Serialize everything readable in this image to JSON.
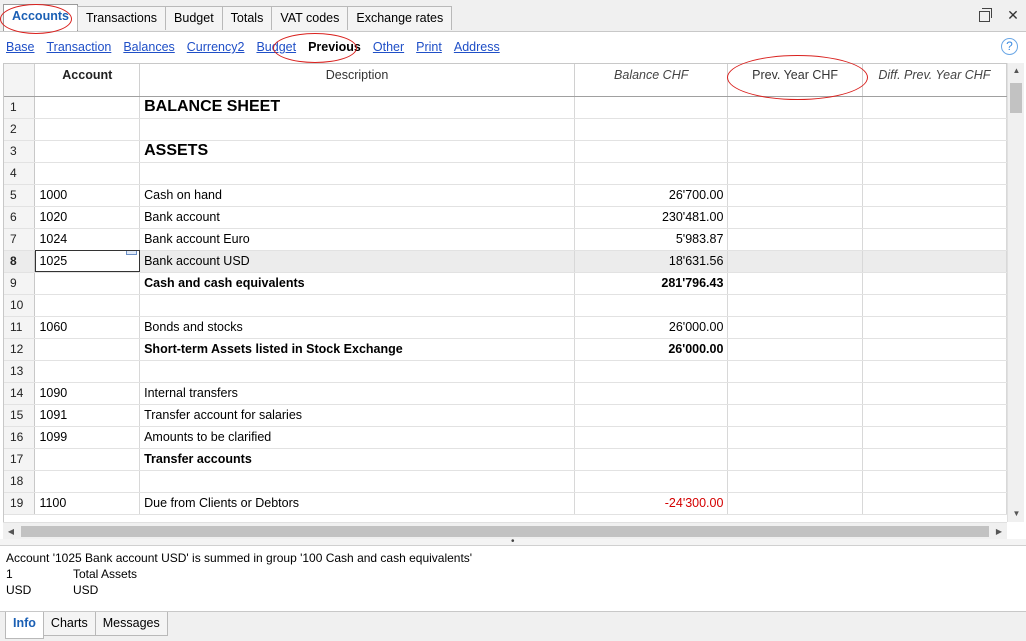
{
  "tabs": [
    "Accounts",
    "Transactions",
    "Budget",
    "Totals",
    "VAT codes",
    "Exchange rates"
  ],
  "active_tab": "Accounts",
  "views": [
    "Base",
    "Transaction",
    "Balances",
    "Currency2",
    "Budget",
    "Previous",
    "Other",
    "Print",
    "Address"
  ],
  "active_view": "Previous",
  "help_icon": "question-circle-icon",
  "columns": {
    "account": "Account",
    "description": "Description",
    "balance": "Balance CHF",
    "prev_year": "Prev. Year CHF",
    "diff_prev_year": "Diff. Prev. Year CHF"
  },
  "rows": [
    {
      "n": "1",
      "account": "",
      "description": "BALANCE SHEET",
      "balance": "",
      "style": "big"
    },
    {
      "n": "2",
      "account": "",
      "description": "",
      "balance": "",
      "style": ""
    },
    {
      "n": "3",
      "account": "",
      "description": "ASSETS",
      "balance": "",
      "style": "big"
    },
    {
      "n": "4",
      "account": "",
      "description": "",
      "balance": "",
      "style": ""
    },
    {
      "n": "5",
      "account": "1000",
      "description": "Cash on hand",
      "balance": "26'700.00",
      "style": ""
    },
    {
      "n": "6",
      "account": "1020",
      "description": "Bank account",
      "balance": "230'481.00",
      "style": ""
    },
    {
      "n": "7",
      "account": "1024",
      "description": "Bank account Euro",
      "balance": "5'983.87",
      "style": ""
    },
    {
      "n": "8",
      "account": "1025",
      "description": "Bank account USD",
      "balance": "18'631.56",
      "style": "sel"
    },
    {
      "n": "9",
      "account": "",
      "description": "Cash and cash equivalents",
      "balance": "281'796.43",
      "style": "bold"
    },
    {
      "n": "10",
      "account": "",
      "description": "",
      "balance": "",
      "style": ""
    },
    {
      "n": "11",
      "account": "1060",
      "description": "Bonds and stocks",
      "balance": "26'000.00",
      "style": ""
    },
    {
      "n": "12",
      "account": "",
      "description": "Short-term Assets listed in Stock Exchange",
      "balance": "26'000.00",
      "style": "bold"
    },
    {
      "n": "13",
      "account": "",
      "description": "",
      "balance": "",
      "style": ""
    },
    {
      "n": "14",
      "account": "1090",
      "description": "Internal transfers",
      "balance": "",
      "style": ""
    },
    {
      "n": "15",
      "account": "1091",
      "description": "Transfer account for salaries",
      "balance": "",
      "style": ""
    },
    {
      "n": "16",
      "account": "1099",
      "description": "Amounts to be clarified",
      "balance": "",
      "style": ""
    },
    {
      "n": "17",
      "account": "",
      "description": "Transfer accounts",
      "balance": "",
      "style": "bold"
    },
    {
      "n": "18",
      "account": "",
      "description": "",
      "balance": "",
      "style": ""
    },
    {
      "n": "19",
      "account": "1100",
      "description": "Due from Clients or Debtors",
      "balance": "-24'300.00",
      "style": "neg"
    }
  ],
  "info": {
    "message": "Account '1025 Bank account USD' is summed in group '100 Cash and cash equivalents'",
    "lines": [
      {
        "key": "1",
        "value": "Total Assets"
      },
      {
        "key": "USD",
        "value": "USD"
      }
    ]
  },
  "bottom_tabs": [
    "Info",
    "Charts",
    "Messages"
  ],
  "active_bottom_tab": "Info",
  "colors": {
    "link": "#1f4fc7",
    "active_tab": "#1a5fb4",
    "negative": "#d40000",
    "annotation": "#d9211e"
  }
}
